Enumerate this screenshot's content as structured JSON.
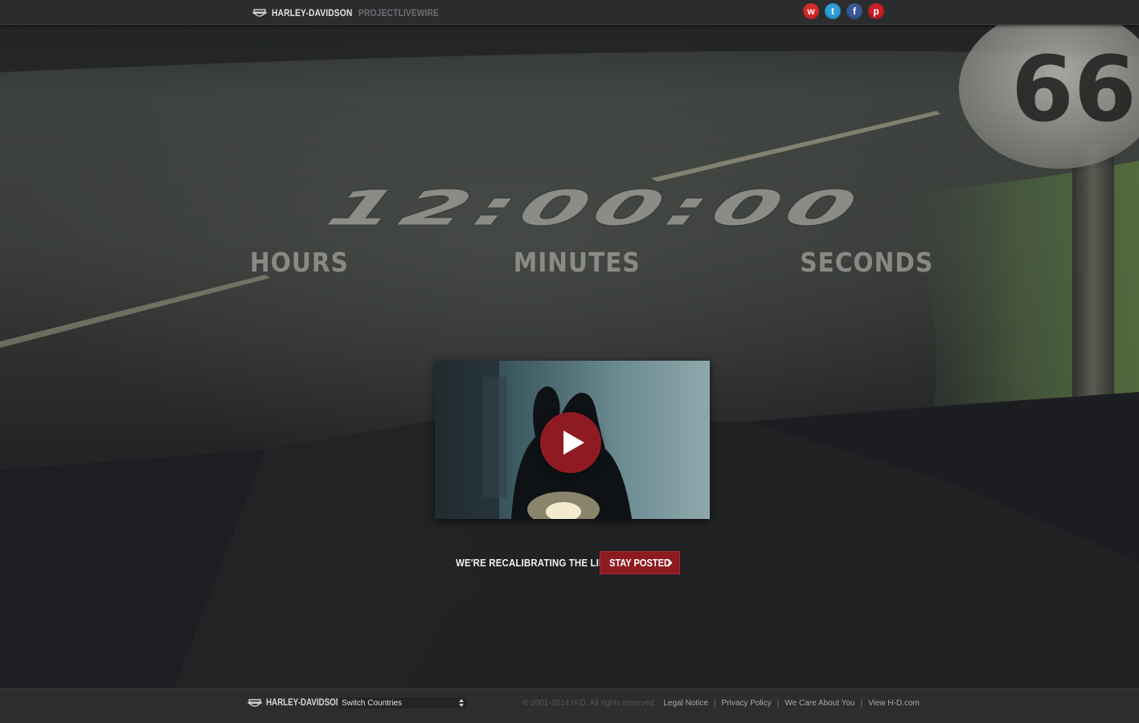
{
  "header": {
    "brand_name": "HARLEY-DAVIDSON",
    "brand_sub": "PROJECTLIVEWIRE",
    "logo_icon": "bar-and-shield-icon",
    "social": [
      {
        "name": "weibo",
        "icon": "weibo-icon",
        "glyph": "w",
        "color": "#d52b2b"
      },
      {
        "name": "twitter",
        "icon": "twitter-icon",
        "glyph": "t",
        "color": "#2f9fd8"
      },
      {
        "name": "facebook",
        "icon": "facebook-icon",
        "glyph": "f",
        "color": "#3b5998"
      },
      {
        "name": "pinterest",
        "icon": "pinterest-icon",
        "glyph": "p",
        "color": "#cb2027"
      }
    ]
  },
  "countdown": {
    "display": "12:00:00",
    "hours_label": "HOURS",
    "minutes_label": "MINUTES",
    "seconds_label": "SECONDS"
  },
  "video": {
    "play_icon": "play-icon"
  },
  "cta": {
    "text": "WE'RE RECALIBRATING THE LIMITS.",
    "button_label": "STAY POSTED",
    "button_icon": "chevron-right-icon"
  },
  "footer": {
    "brand_name": "HARLEY-DAVIDSON",
    "country_select": "Switch Countries",
    "copyright": "© 2001-2014 H-D. All rights reserved.",
    "links": [
      "Legal Notice",
      "Privacy Policy",
      "We Care About You",
      "View H-D.com"
    ]
  },
  "colors": {
    "accent_red": "#8d1a20",
    "header_bg": "#2b2c2e",
    "footer_bg": "#2c2d2f"
  }
}
